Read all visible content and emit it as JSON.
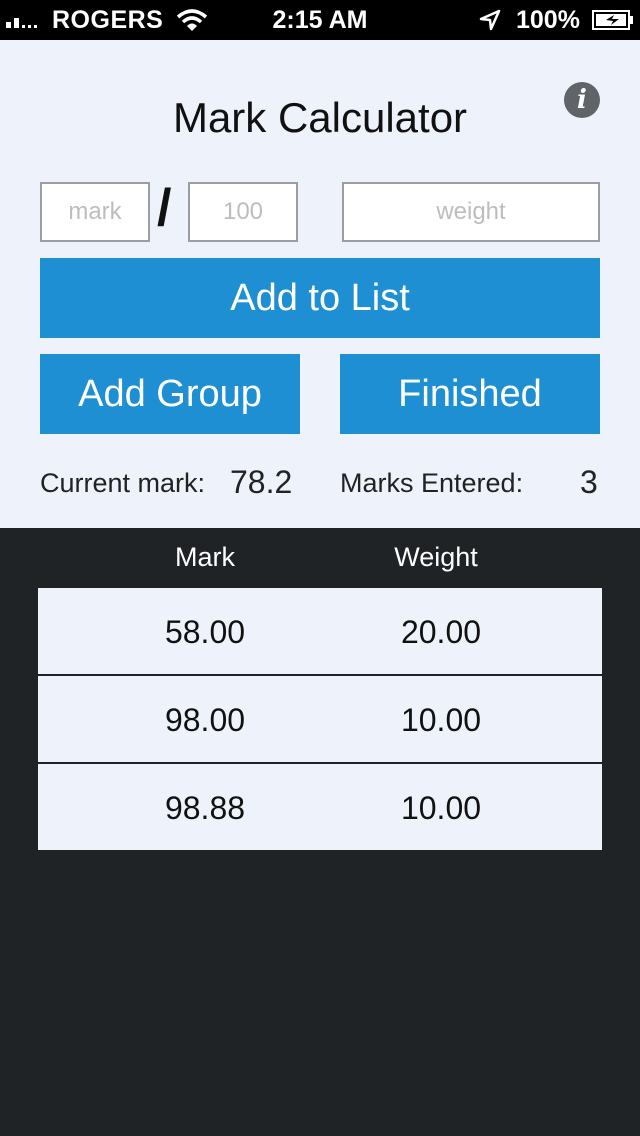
{
  "status_bar": {
    "carrier": "ROGERS",
    "time": "2:15 AM",
    "battery_percent": "100%",
    "icons": [
      "signal-icon",
      "wifi-icon",
      "location-icon",
      "battery-icon"
    ]
  },
  "header": {
    "title": "Mark Calculator",
    "info_icon": "info-icon"
  },
  "form": {
    "mark_placeholder": "mark",
    "total_placeholder": "100",
    "weight_placeholder": "weight",
    "separator": "/"
  },
  "buttons": {
    "add_to_list": "Add to List",
    "add_group": "Add Group",
    "finished": "Finished"
  },
  "stats": {
    "current_mark_label": "Current mark:",
    "current_mark_value": "78.2",
    "marks_entered_label": "Marks Entered:",
    "marks_entered_value": "3"
  },
  "table": {
    "headers": {
      "mark": "Mark",
      "weight": "Weight"
    },
    "rows": [
      {
        "mark": "58.00",
        "weight": "20.00"
      },
      {
        "mark": "98.00",
        "weight": "10.00"
      },
      {
        "mark": "98.88",
        "weight": "10.00"
      }
    ]
  },
  "colors": {
    "accent": "#1f8fd3",
    "panel_bg": "#eef3fb",
    "dark_bg": "#202326"
  }
}
